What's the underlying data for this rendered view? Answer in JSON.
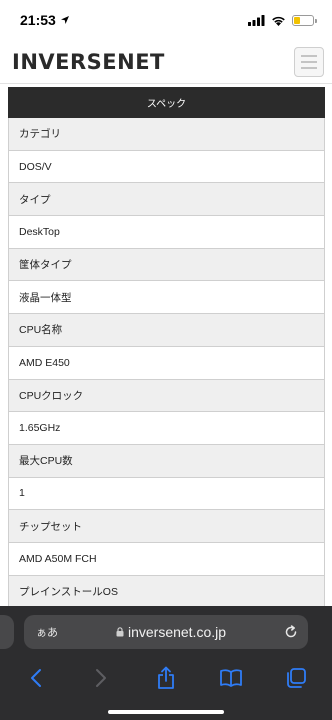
{
  "status_bar": {
    "time": "21:53",
    "battery_color": "#f2c200",
    "battery_level": 0.35
  },
  "header": {
    "logo": "INVERSENET",
    "menu_icon": "hamburger-icon"
  },
  "spec": {
    "title": "スペック",
    "rows": [
      {
        "type": "label",
        "text": "カテゴリ"
      },
      {
        "type": "value",
        "text": "DOS/V"
      },
      {
        "type": "label",
        "text": "タイプ"
      },
      {
        "type": "value",
        "text": "DeskTop"
      },
      {
        "type": "label",
        "text": "筐体タイプ"
      },
      {
        "type": "value",
        "text": "液晶一体型"
      },
      {
        "type": "label",
        "text": "CPU名称"
      },
      {
        "type": "value",
        "text": "AMD E450"
      },
      {
        "type": "label",
        "text": "CPUクロック"
      },
      {
        "type": "value",
        "text": "1.65GHz"
      },
      {
        "type": "label",
        "text": "最大CPU数"
      },
      {
        "type": "value",
        "text": "1"
      },
      {
        "type": "label",
        "text": "チップセット"
      },
      {
        "type": "value",
        "text": "AMD A50M FCH"
      },
      {
        "type": "label",
        "text": "プレインストールOS"
      }
    ]
  },
  "safari": {
    "aa_label": "ぁあ",
    "url": "inversenet.co.jp",
    "accent_color": "#2f7cf6",
    "icons": [
      "back-icon",
      "forward-icon",
      "share-icon",
      "bookmarks-icon",
      "tabs-icon",
      "reload-icon",
      "lock-icon"
    ]
  }
}
